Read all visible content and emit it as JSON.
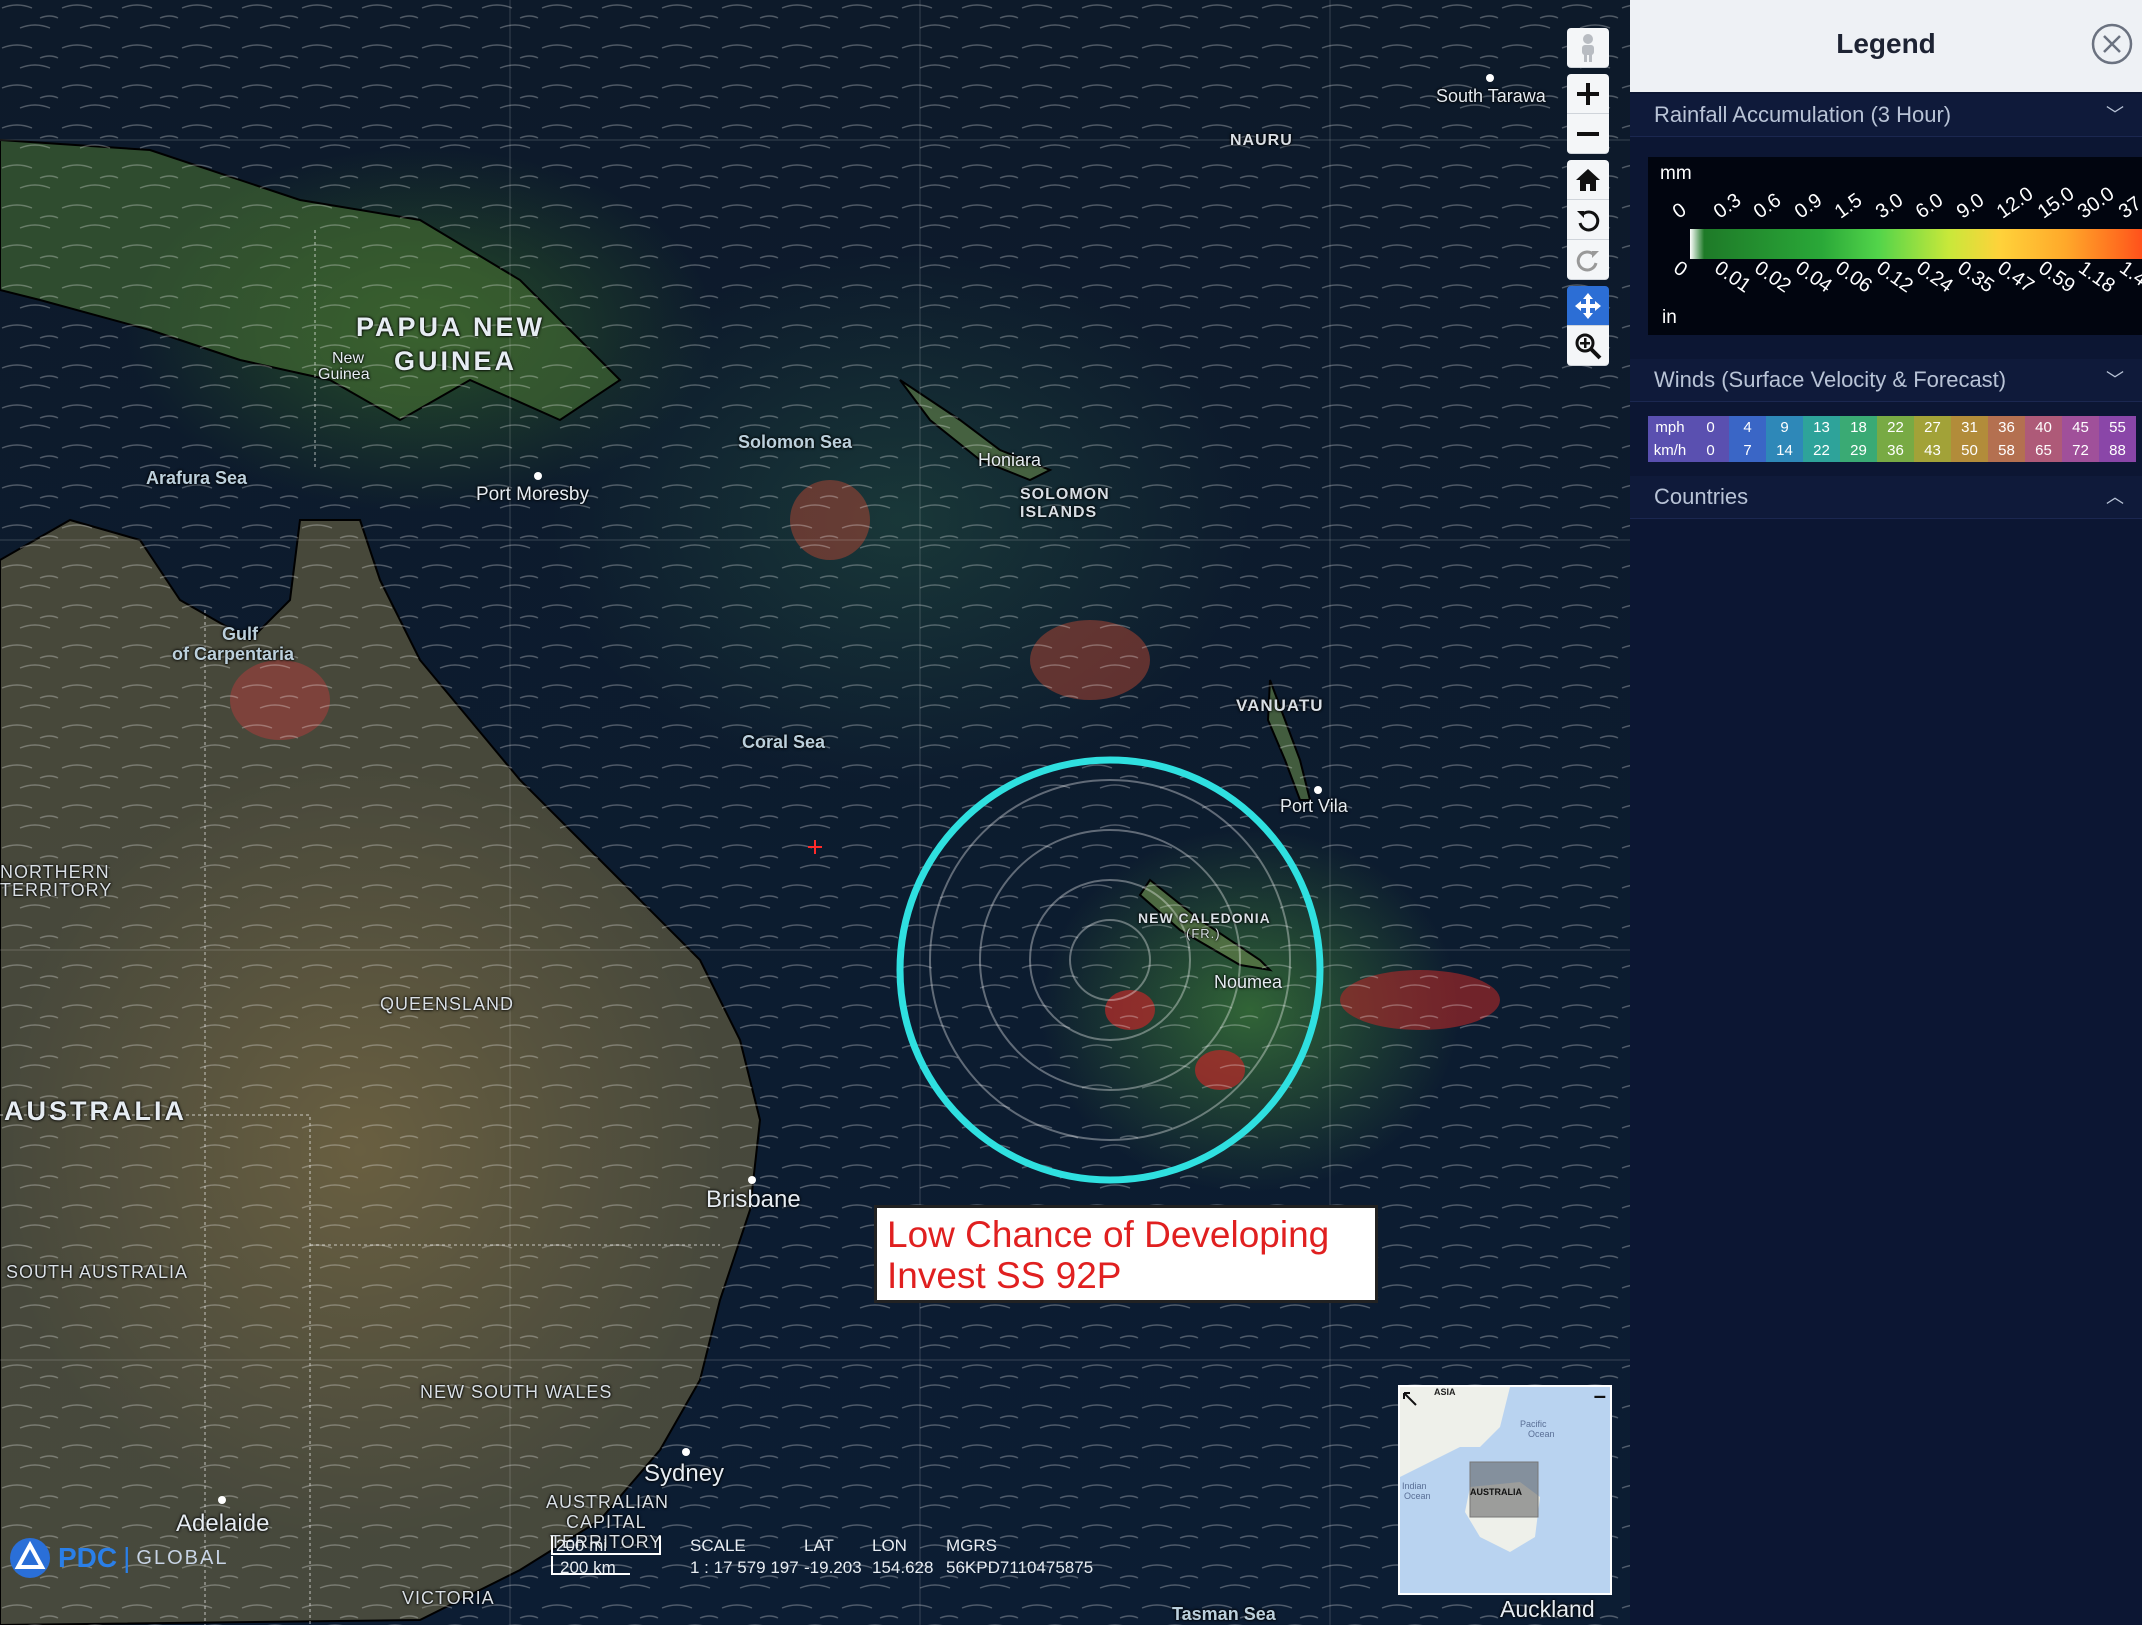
{
  "map": {
    "countries": [
      "PAPUA NEW",
      "GUINEA",
      "AUSTRALIA",
      "NAURU",
      "VANUATU"
    ],
    "solomon_label": [
      "SOLOMON",
      "ISLANDS"
    ],
    "new_caledonia_label": [
      "NEW CALEDONIA",
      "(FR.)"
    ],
    "regions": {
      "northern_territory": [
        "NORTHERN",
        "TERRITORY"
      ],
      "queensland": "QUEENSLAND",
      "south_australia": "SOUTH AUSTRALIA",
      "new_south_wales": "NEW SOUTH WALES",
      "act": [
        "AUSTRALIAN",
        "CAPITAL",
        "TERRITORY"
      ],
      "victoria": "VICTORIA"
    },
    "seas": {
      "solomon": "Solomon Sea",
      "arafura": "Arafura Sea",
      "coral": "Coral Sea",
      "gulf": [
        "Gulf",
        "of Carpentaria"
      ],
      "tasman": "Tasman Sea"
    },
    "cities": {
      "south_tarawa": "South Tarawa",
      "honiara": "Honiara",
      "port_moresby": "Port Moresby",
      "port_vila": "Port Vila",
      "noumea": "Noumea",
      "brisbane": "Brisbane",
      "sydney": "Sydney",
      "adelaide": "Adelaide",
      "auckland": "Auckland",
      "new_guinea": [
        "New",
        "Guinea"
      ]
    }
  },
  "alert": {
    "line1": "Low Chance of Developing",
    "line2": "Invest SS 92P",
    "color": "#e02020",
    "circle_color": "#2fe0e0"
  },
  "toolbar": {
    "buttons": [
      "pegman-icon",
      "zoom-in-icon",
      "zoom-out-icon",
      "home-icon",
      "rotate-ccw-icon",
      "rotate-cw-icon",
      "pan-icon",
      "zoom-box-icon"
    ],
    "active": "pan-icon"
  },
  "status": {
    "scale_bar_mi": "200 mi",
    "scale_bar_km": "200 km",
    "scale_label": "SCALE",
    "scale_value": "1 : 17 579 197",
    "lat_label": "LAT",
    "lat_value": "-19.203",
    "lon_label": "LON",
    "lon_value": "154.628",
    "mgrs_label": "MGRS",
    "mgrs_value": "56KPD7110475875"
  },
  "logo": {
    "brand": "PDC",
    "product": "GLOBAL"
  },
  "overview": {
    "labels": {
      "asia": "ASIA",
      "pacific": [
        "Pacific",
        "Ocean"
      ],
      "indian": [
        "Indian",
        "Ocean"
      ],
      "australia": "AUSTRALIA"
    },
    "collapse": "–"
  },
  "legend": {
    "title": "Legend",
    "rainfall": {
      "header": "Rainfall Accumulation (3 Hour)",
      "unit_mm": "mm",
      "unit_in": "in",
      "mm_values": [
        "0",
        "0.3",
        "0.6",
        "0.9",
        "1.5",
        "3.0",
        "6.0",
        "9.0",
        "12.0",
        "15.0",
        "30.0",
        "37."
      ],
      "in_values": [
        "0",
        "0.01",
        "0.02",
        "0.04",
        "0.06",
        "0.12",
        "0.24",
        "0.35",
        "0.47",
        "0.59",
        "1.18",
        "1.4"
      ]
    },
    "winds": {
      "header": "Winds (Surface Velocity & Forecast)",
      "mph_label": "mph",
      "kmh_label": "km/h",
      "mph": [
        "0",
        "4",
        "9",
        "13",
        "18",
        "22",
        "27",
        "31",
        "36",
        "40",
        "45",
        "55"
      ],
      "kmh": [
        "0",
        "7",
        "14",
        "22",
        "29",
        "36",
        "43",
        "50",
        "58",
        "65",
        "72",
        "88"
      ],
      "colors": [
        "#5a50b0",
        "#3a66c6",
        "#2e88b8",
        "#2ea39a",
        "#3aaa74",
        "#78aa44",
        "#a2a238",
        "#b28c3a",
        "#b47050",
        "#ae5a78",
        "#a0509a",
        "#8a46a8"
      ]
    },
    "countries": {
      "header": "Countries"
    }
  }
}
